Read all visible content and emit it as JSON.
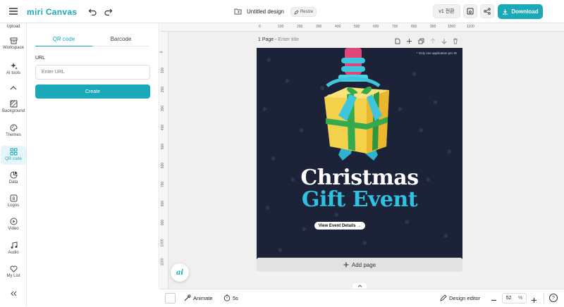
{
  "app": {
    "logo_text": "miri Canvas",
    "doc_title": "Untitled design",
    "resize_label": "Resize",
    "version_label": "v1 전환",
    "download_label": "Download",
    "brand_color": "#1aa9b8"
  },
  "rail": {
    "upload": "Upload",
    "workspace": "Workspace",
    "ai_tools": "AI tools",
    "background": "Background",
    "themes": "Themes",
    "qr_code": "QR code",
    "data": "Data",
    "logos": "Logos",
    "video": "Video",
    "audio": "Audio",
    "my_list": "My List"
  },
  "panel": {
    "tab_qr": "QR code",
    "tab_barcode": "Barcode",
    "url_label": "URL",
    "url_placeholder": "Enter URL",
    "create_label": "Create"
  },
  "canvas": {
    "page_label": "1 Page - ",
    "page_title_placeholder": "Enter title",
    "note": "* Only one application per ID",
    "headline1": "Christmas",
    "headline2": "Gift Event",
    "cta": "View Event Details →",
    "add_page": "Add page"
  },
  "ruler": {
    "h_ticks": [
      "0",
      "100",
      "200",
      "300",
      "400",
      "500",
      "600",
      "700",
      "800",
      "900",
      "1000",
      "1100"
    ],
    "v_ticks": [
      "0",
      "100",
      "200",
      "300",
      "400",
      "500",
      "600",
      "700",
      "800",
      "900",
      "1000",
      "1100"
    ]
  },
  "bottom": {
    "animate": "Animate",
    "duration": "5s",
    "design_editor": "Design editor",
    "zoom": "52",
    "zoom_unit": "%",
    "help": "?"
  }
}
